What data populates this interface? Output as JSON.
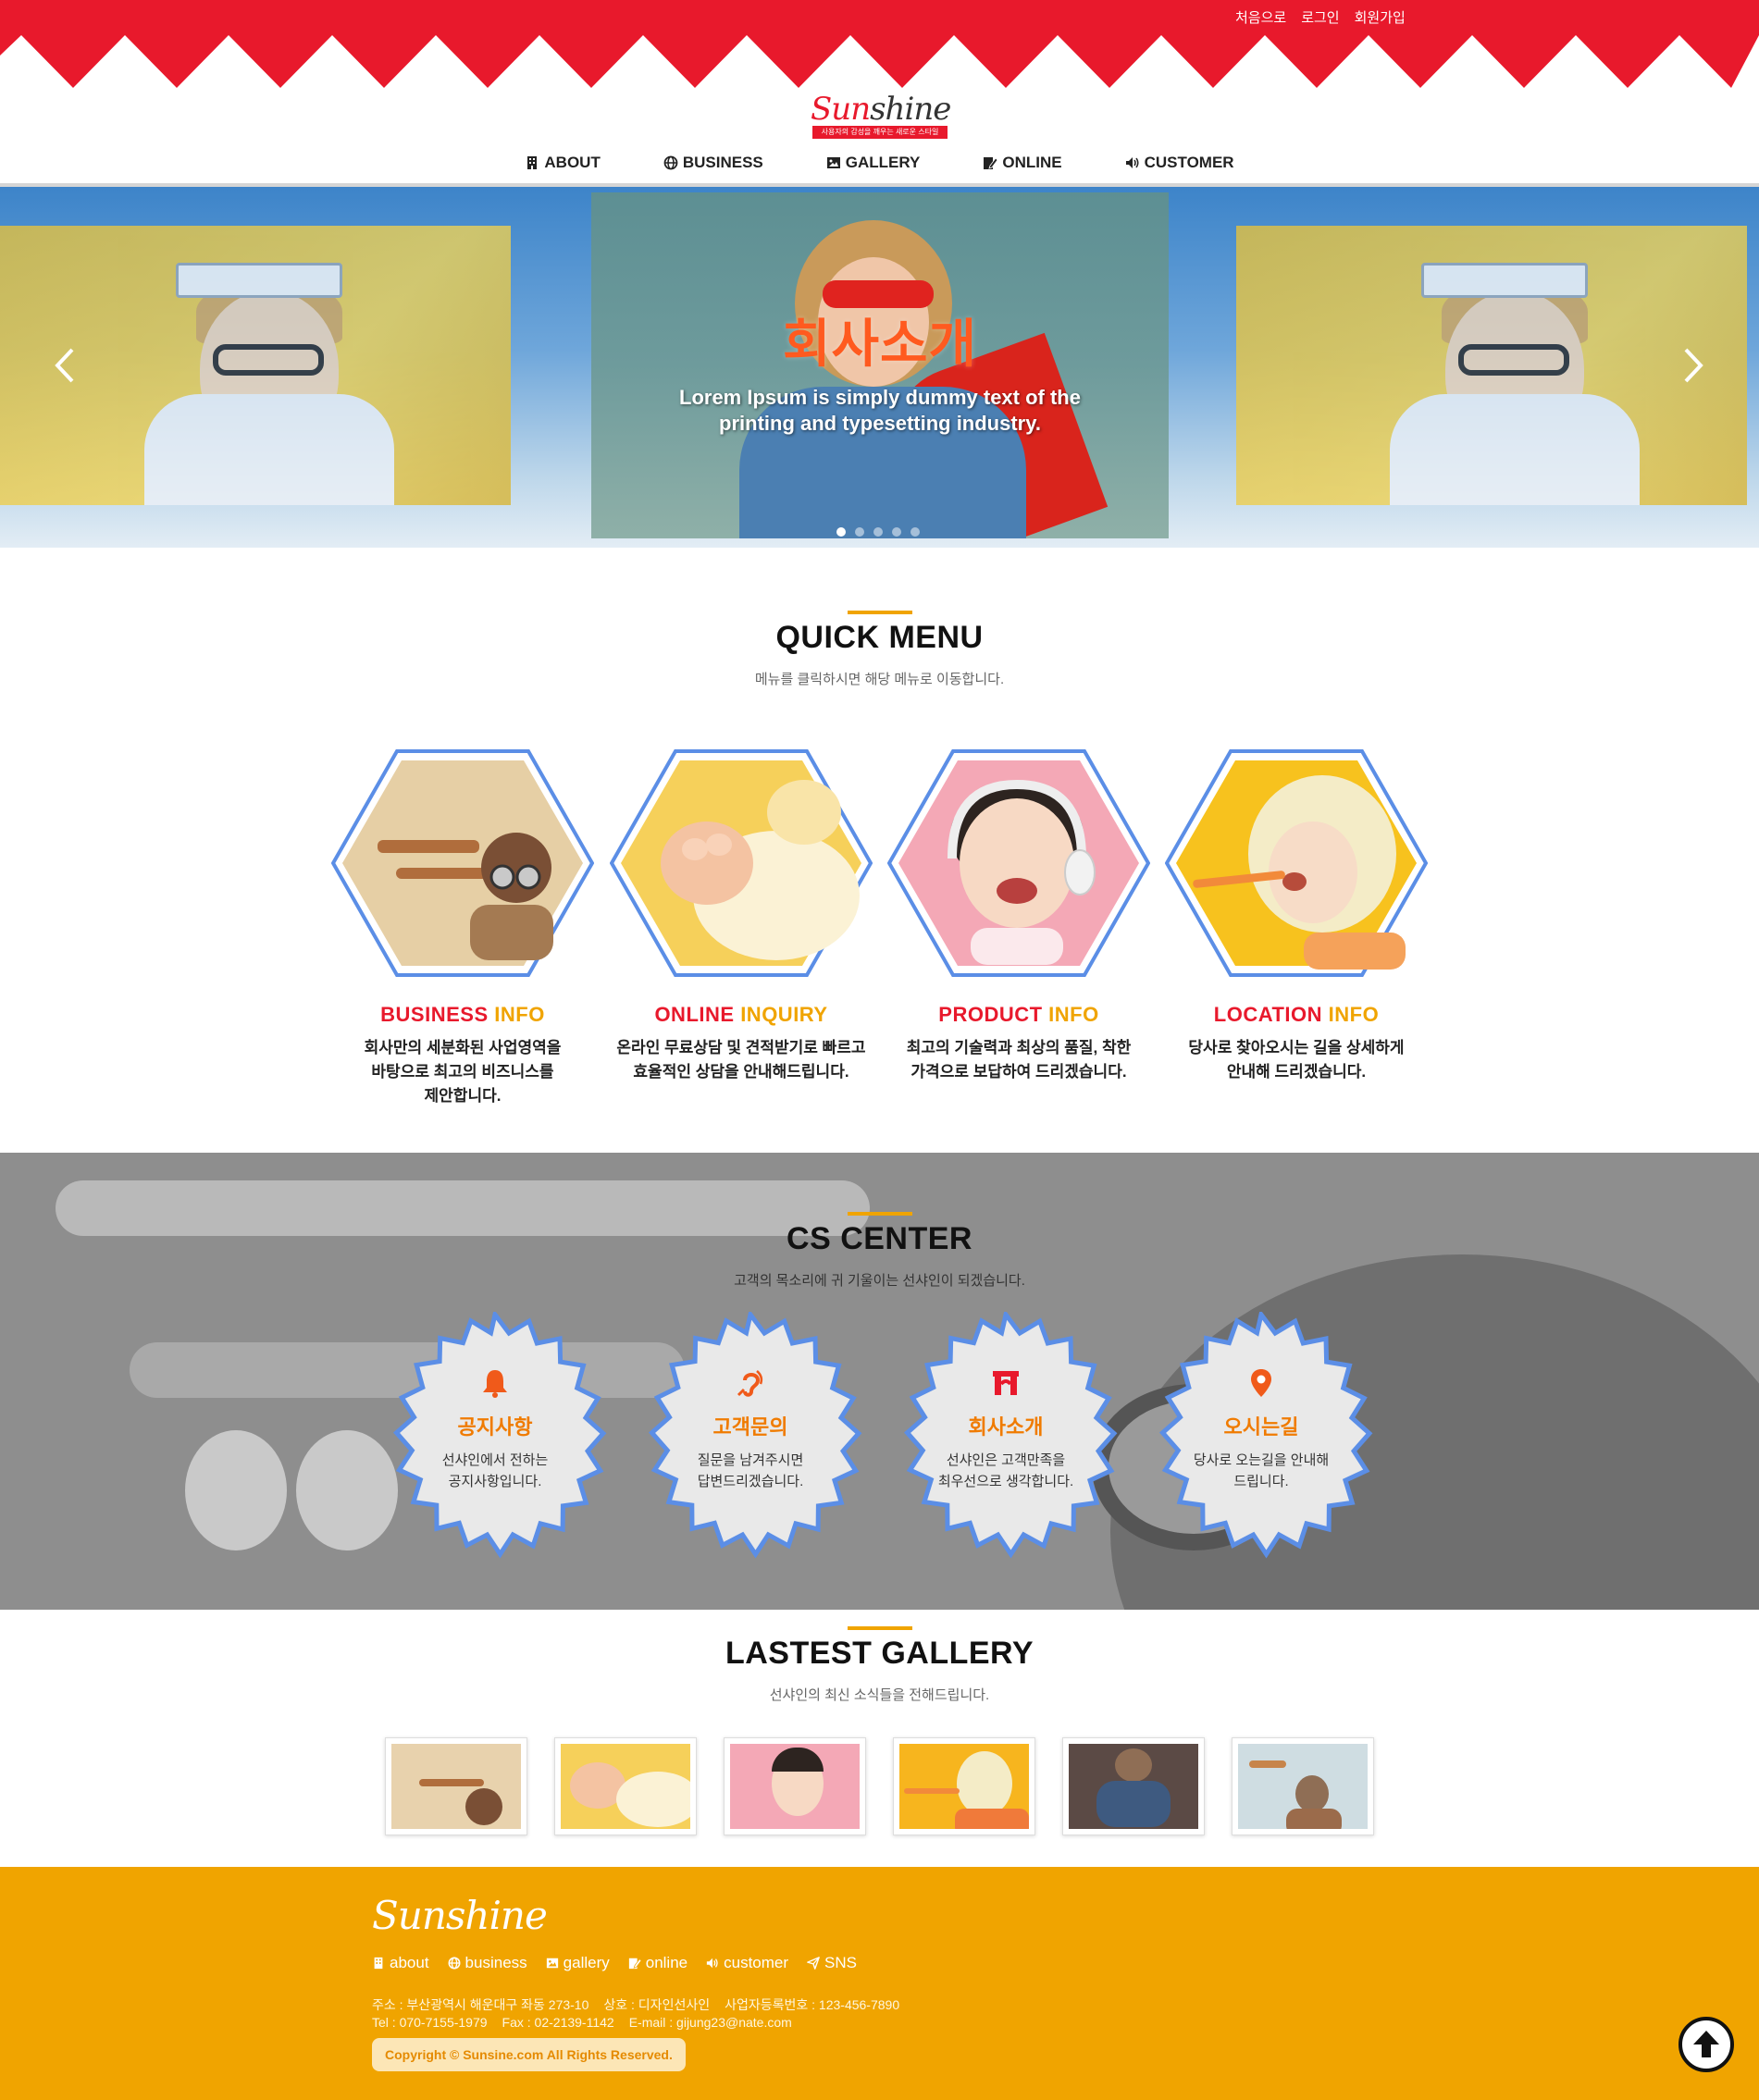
{
  "colors": {
    "brand_red": "#e8192c",
    "accent_orange": "#f0a400",
    "hex_border": "#5b8ee6"
  },
  "top_links": [
    "처음으로",
    "로그인",
    "회원가입"
  ],
  "logo": {
    "su": "Sun",
    "rest": "shine",
    "tagline": "사용자의 감성을 깨우는 새로운 스타일"
  },
  "nav": [
    {
      "label": "ABOUT",
      "icon": "building-icon"
    },
    {
      "label": "BUSINESS",
      "icon": "globe-icon"
    },
    {
      "label": "GALLERY",
      "icon": "image-icon"
    },
    {
      "label": "ONLINE",
      "icon": "edit-icon"
    },
    {
      "label": "CUSTOMER",
      "icon": "speaker-icon"
    }
  ],
  "hero": {
    "title": "회사소개",
    "subtitle_line1": "Lorem Ipsum is simply dummy text of the",
    "subtitle_line2": "printing and typesetting industry.",
    "slide_count": 5,
    "active_slide": 1
  },
  "quick_menu": {
    "title": "QUICK MENU",
    "subtitle": "메뉴를 클릭하시면 해당 메뉴로 이동합니다.",
    "items": [
      {
        "title_a": "BUSINESS",
        "title_b": "INFO",
        "line1": "회사만의 세분화된 사업영역을",
        "line2": "바탕으로 최고의 비즈니스를",
        "line3": "제안합니다."
      },
      {
        "title_a": "ONLINE",
        "title_b": "INQUIRY",
        "line1": "온라인 무료상담 및 견적받기로 빠르고",
        "line2": "효율적인 상담을 안내해드립니다.",
        "line3": ""
      },
      {
        "title_a": "PRODUCT",
        "title_b": "INFO",
        "line1": "최고의 기술력과 최상의 품질, 착한",
        "line2": "가격으로 보답하여 드리겠습니다.",
        "line3": ""
      },
      {
        "title_a": "LOCATION",
        "title_b": "INFO",
        "line1": "당사로 찾아오시는 길을 상세하게",
        "line2": "안내해 드리겠습니다.",
        "line3": ""
      }
    ]
  },
  "cs_center": {
    "title": "CS CENTER",
    "subtitle": "고객의 목소리에 귀 기울이는 선샤인이 되겠습니다.",
    "items": [
      {
        "title": "공지사항",
        "line1": "선샤인에서 전하는",
        "line2": "공지사항입니다.",
        "icon": "bell-icon"
      },
      {
        "title": "고객문의",
        "line1": "질문을 남겨주시면",
        "line2": "답변드리겠습니다.",
        "icon": "hearing-icon"
      },
      {
        "title": "회사소개",
        "line1": "선샤인은 고객만족을",
        "line2": "최우선으로 생각합니다.",
        "icon": "archway-icon"
      },
      {
        "title": "오시는길",
        "line1": "당사로 오는길을 안내해",
        "line2": "드립니다.",
        "icon": "map-marker-icon"
      }
    ]
  },
  "gallery": {
    "title": "LASTEST GALLERY",
    "subtitle": "선샤인의 최신 소식들을 전해드립니다.",
    "thumb_count": 6
  },
  "footer": {
    "logo": "Sunshine",
    "nav": [
      {
        "label": "about",
        "icon": "building-icon"
      },
      {
        "label": "business",
        "icon": "globe-icon"
      },
      {
        "label": "gallery",
        "icon": "image-icon"
      },
      {
        "label": "online",
        "icon": "edit-icon"
      },
      {
        "label": "customer",
        "icon": "speaker-icon"
      },
      {
        "label": "SNS",
        "icon": "send-icon"
      }
    ],
    "address": "주소 : 부산광역시 해운대구 좌동 273-10",
    "company": "상호 : 디자인선사인",
    "biz_no": "사업자등록번호 : 123-456-7890",
    "tel": "Tel : 070-7155-1979",
    "fax": "Fax : 02-2139-1142",
    "email": "E-mail : gijung23@nate.com",
    "copyright": "Copyright © Sunsine.com All Rights Reserved."
  }
}
